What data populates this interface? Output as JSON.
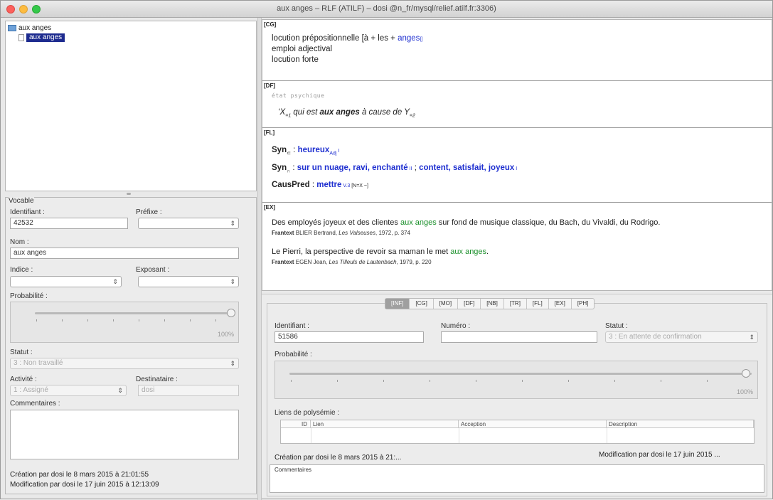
{
  "window": {
    "title": "aux anges – RLF (ATILF) – dosi @n_fr/mysql/relief.atilf.fr:3306)"
  },
  "tree": {
    "root_label": "aux anges",
    "child_label": "aux anges"
  },
  "vocable": {
    "legend": "Vocable",
    "identifiant_label": "Identifiant :",
    "identifiant_value": "42532",
    "prefixe_label": "Préfixe :",
    "prefixe_value": "",
    "nom_label": "Nom :",
    "nom_value": "aux anges",
    "indice_label": "Indice :",
    "indice_value": "",
    "exposant_label": "Exposant :",
    "exposant_value": "",
    "probabilite_label": "Probabilité :",
    "probabilite_value": 1.0,
    "probabilite_pct": "100%",
    "statut_label": "Statut :",
    "statut_value": "3 : Non travaillé",
    "activite_label": "Activité :",
    "activite_value": "1 : Assigné",
    "destinataire_label": "Destinataire :",
    "destinataire_value": "dosi",
    "commentaires_label": "Commentaires :",
    "creation": "Création par dosi le 8 mars 2015 à 21:01:55",
    "modification": "Modification par dosi le 17 juin 2015 à 12:13:09"
  },
  "article": {
    "cg_tag": "[CG]",
    "cg_line1_a": "locution prépositionnelle [à + les + ",
    "cg_line1_b": "anges",
    "cg_line1_c": "|]",
    "cg_line2": "emploi adjectival",
    "cg_line3": "locution forte",
    "df_tag": "[DF]",
    "df_line1": "état psychique",
    "df_line2_a": "‘X",
    "df_line2_sub1": "=1",
    "df_line2_b": " qui est ",
    "df_line2_c": "aux anges",
    "df_line2_d": " à cause de Y",
    "df_line2_sub2": "=2",
    "fl_tag": "[FL]",
    "fl1_a": "Syn",
    "fl1_sub": "⊂",
    "fl1_b": " : ",
    "fl1_c": "heureux",
    "fl1_sub2": "Adj",
    "fl1_d": " I",
    "fl2_a": "Syn",
    "fl2_sub": "∩",
    "fl2_b": " : ",
    "fl2_c": "sur un nuage, ravi, enchanté",
    "fl2_d": " II",
    "fl2_e": " ; ",
    "fl2_f": "content, satisfait, joyeux",
    "fl2_g": " I",
    "fl3_a": "CausPred",
    "fl3_b": " : ",
    "fl3_c": "mettre",
    "fl3_d": " V.3",
    "fl3_e": " [N=X ~]",
    "ex_tag": "[EX]",
    "ex1_a": "Des employés joyeux et des clientes ",
    "ex1_b": "aux anges",
    "ex1_c": " sur fond de musique classique, du Bach, du Vivaldi, du Rodrigo.",
    "ex1_src_a": "Frantext",
    "ex1_src_b": " BLIER Bertrand, ",
    "ex1_src_c": "Les Valseuses",
    "ex1_src_d": ", 1972, p. 374",
    "ex2_a": "Le Pierri, la perspective de revoir sa maman le met ",
    "ex2_b": "aux anges",
    "ex2_c": ".",
    "ex2_src_a": "Frantext",
    "ex2_src_b": " EGEN Jean, ",
    "ex2_src_c": "Les Tilleuls de Lautenbach",
    "ex2_src_d": ", 1979, p. 220"
  },
  "panel": {
    "tabs": [
      "[INF]",
      "[CG]",
      "[MO]",
      "[DF]",
      "[NB]",
      "[TR]",
      "[FL]",
      "[EX]",
      "[PH]"
    ],
    "identifiant_label": "Identifiant :",
    "identifiant_value": "51586",
    "numero_label": "Numéro :",
    "numero_value": "",
    "statut_label": "Statut :",
    "statut_value": "3 : En attente de confirmation",
    "probabilite_label": "Probabilité :",
    "probabilite_value": 1.0,
    "probabilite_pct": "100%",
    "liens_label": "Liens de polysémie :",
    "columns": [
      "ID",
      "Lien",
      "Acception",
      "Description"
    ],
    "creation": "Création par dosi le 8 mars 2015 à 21:...",
    "modification": "Modification par dosi le 17 juin 2015 ...",
    "commentaires_label": "Commentaires"
  }
}
